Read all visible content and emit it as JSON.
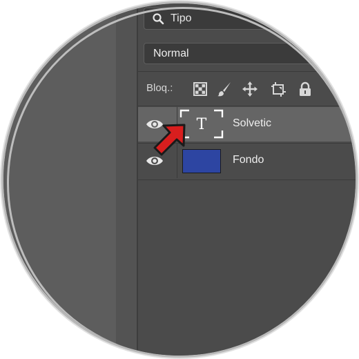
{
  "layers_panel": {
    "filter": {
      "kind_label": "Tipo"
    },
    "blend_mode": "Normal",
    "lock": {
      "label": "Bloq.:"
    },
    "layers": [
      {
        "name": "Solvetic",
        "type": "text",
        "selected": true,
        "thumb_glyph": "T"
      },
      {
        "name": "Fondo",
        "type": "fill",
        "selected": false,
        "thumb_color": "#2d45a2"
      }
    ]
  },
  "colors": {
    "panel_bg": "#4b4b4b",
    "selected_row": "#656565",
    "arrow": "#d81e1e",
    "fondo_fill": "#2d45a2"
  },
  "icons": [
    "search-icon",
    "eye-icon",
    "lock-transparent-pixels-icon",
    "lock-image-pixels-icon",
    "lock-position-icon",
    "lock-artboard-icon",
    "lock-all-icon",
    "type-layer-icon",
    "pointer-arrow-icon"
  ]
}
